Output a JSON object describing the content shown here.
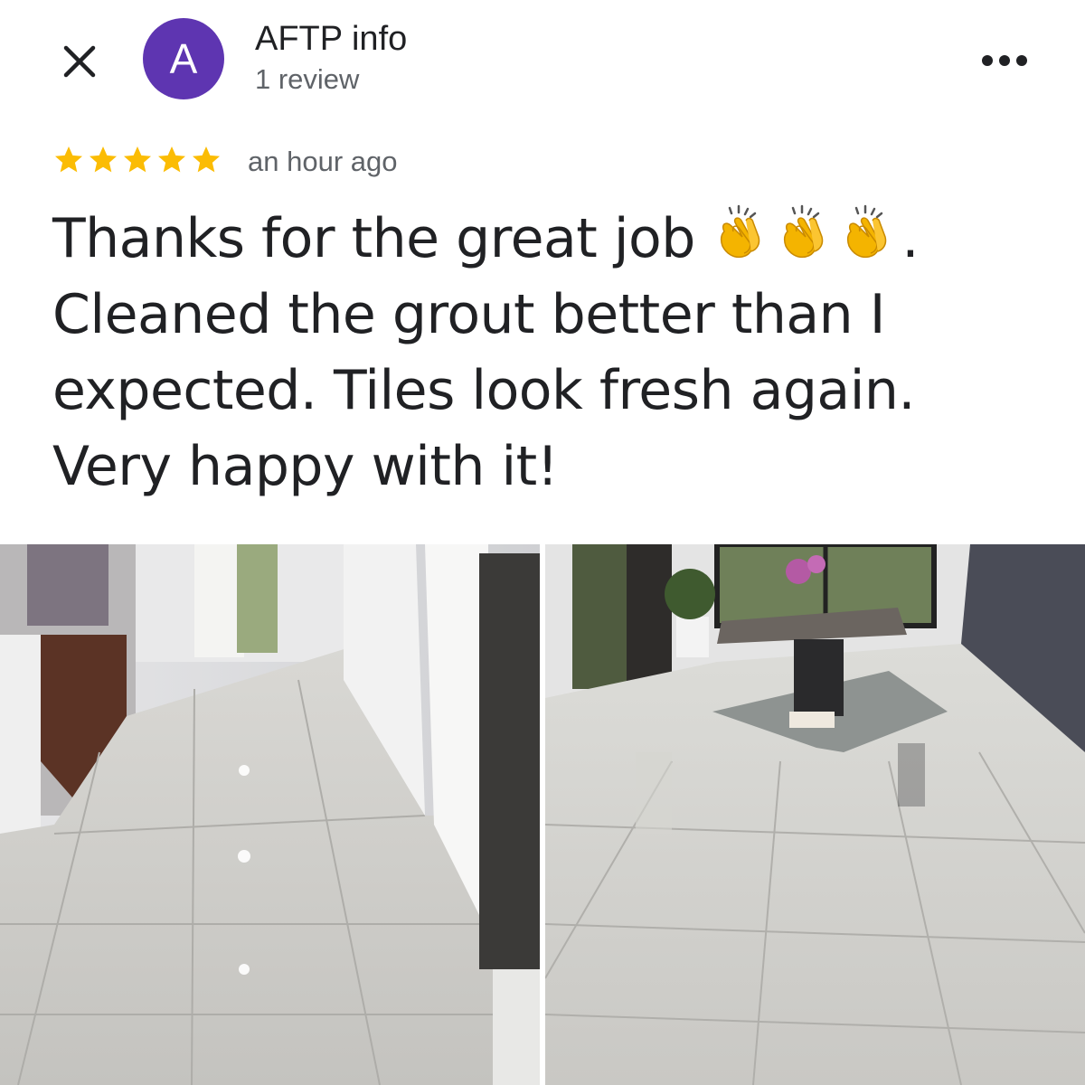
{
  "reviewer": {
    "initial": "A",
    "name": "AFTP info",
    "review_count": "1 review",
    "avatar_color": "#5e35b1"
  },
  "review": {
    "rating": 5,
    "star_color": "#fbbc04",
    "time": "an hour ago",
    "text_lines": [
      "Thanks for the great job",
      "Cleaned the grout better than I",
      "expected. Tiles look fresh again.",
      "Very happy with it!"
    ],
    "line1_suffix": "."
  },
  "icons": {
    "close": "close-icon",
    "more": "more-horiz-icon",
    "star": "star-icon",
    "emoji": "clapping-hands-emoji"
  },
  "photos": [
    {
      "name": "hallway-floor-photo"
    },
    {
      "name": "dining-room-floor-photo"
    }
  ]
}
